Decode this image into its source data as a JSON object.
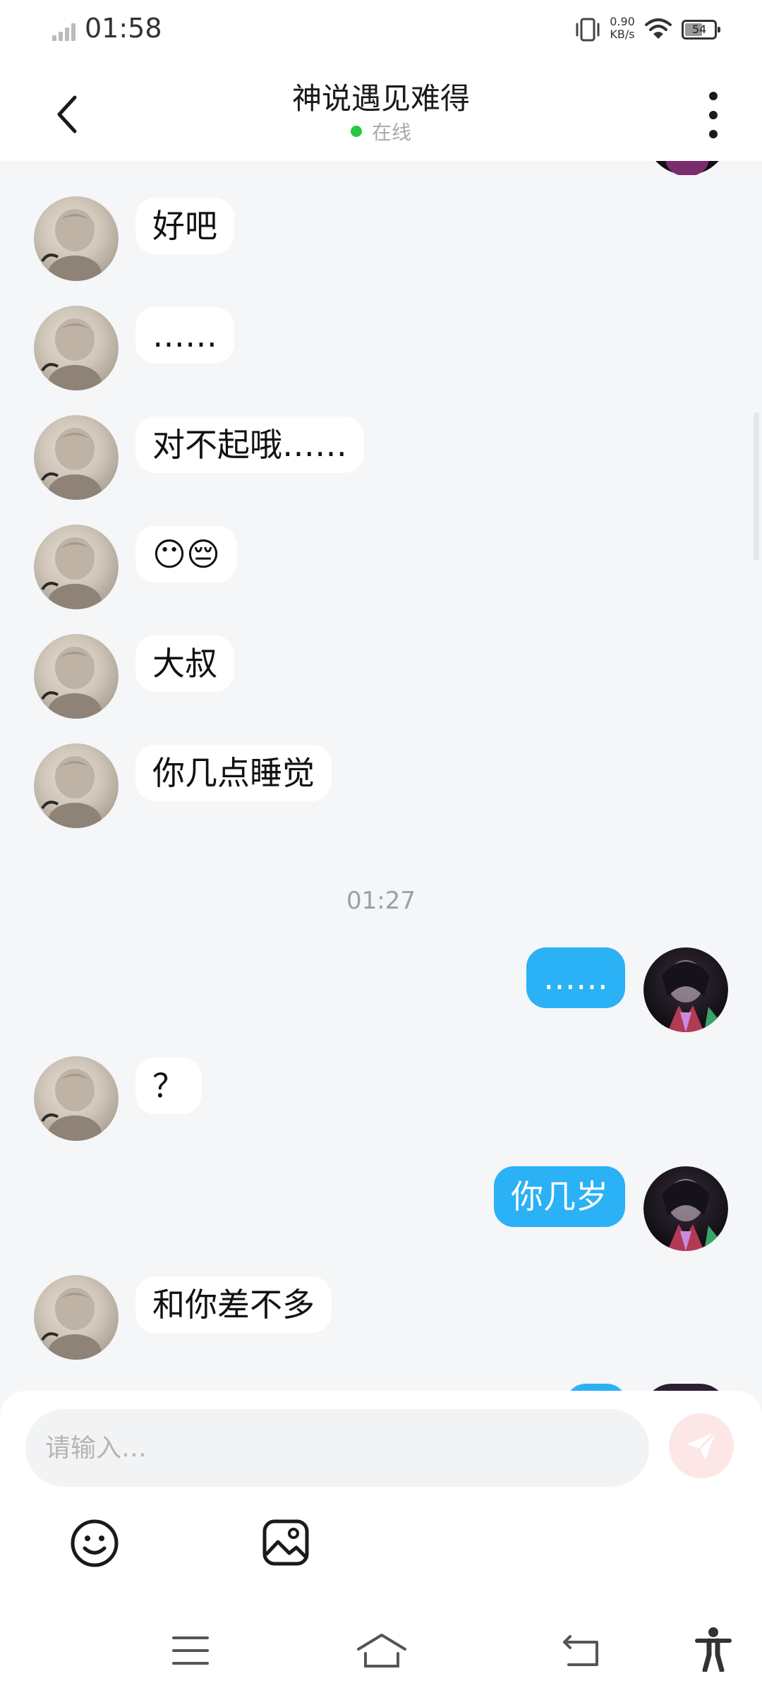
{
  "status_bar": {
    "time": "01:58",
    "net_speed_value": "0.90",
    "net_speed_unit": "KB/s",
    "battery": "54"
  },
  "header": {
    "title": "神说遇见难得",
    "status": "在线"
  },
  "messages": [
    {
      "side": "incoming",
      "text": "好吧"
    },
    {
      "side": "incoming",
      "text": "……"
    },
    {
      "side": "incoming",
      "text": "对不起哦……"
    },
    {
      "side": "incoming",
      "text": "😶😔"
    },
    {
      "side": "incoming",
      "text": "大叔"
    },
    {
      "side": "incoming",
      "text": "你几点睡觉"
    },
    {
      "side": "timestamp",
      "text": "01:27"
    },
    {
      "side": "outgoing",
      "text": "……"
    },
    {
      "side": "incoming",
      "text": "？"
    },
    {
      "side": "outgoing",
      "text": "你几岁"
    },
    {
      "side": "incoming",
      "text": "和你差不多"
    }
  ],
  "composer": {
    "placeholder": "请输入…"
  },
  "icons": {
    "back": "chevron-left-icon",
    "more": "more-vertical-icon",
    "send": "send-icon",
    "emoji": "smiley-icon",
    "image": "image-icon",
    "nav_menu": "menu-icon",
    "nav_home": "home-icon",
    "nav_back": "return-icon",
    "accessibility": "accessibility-icon"
  },
  "colors": {
    "outgoing_bubble": "#2bb1f5",
    "incoming_bubble": "#ffffff",
    "background": "#f4f6f8",
    "online_dot": "#27c93f",
    "send_button": "#fde6e6"
  }
}
